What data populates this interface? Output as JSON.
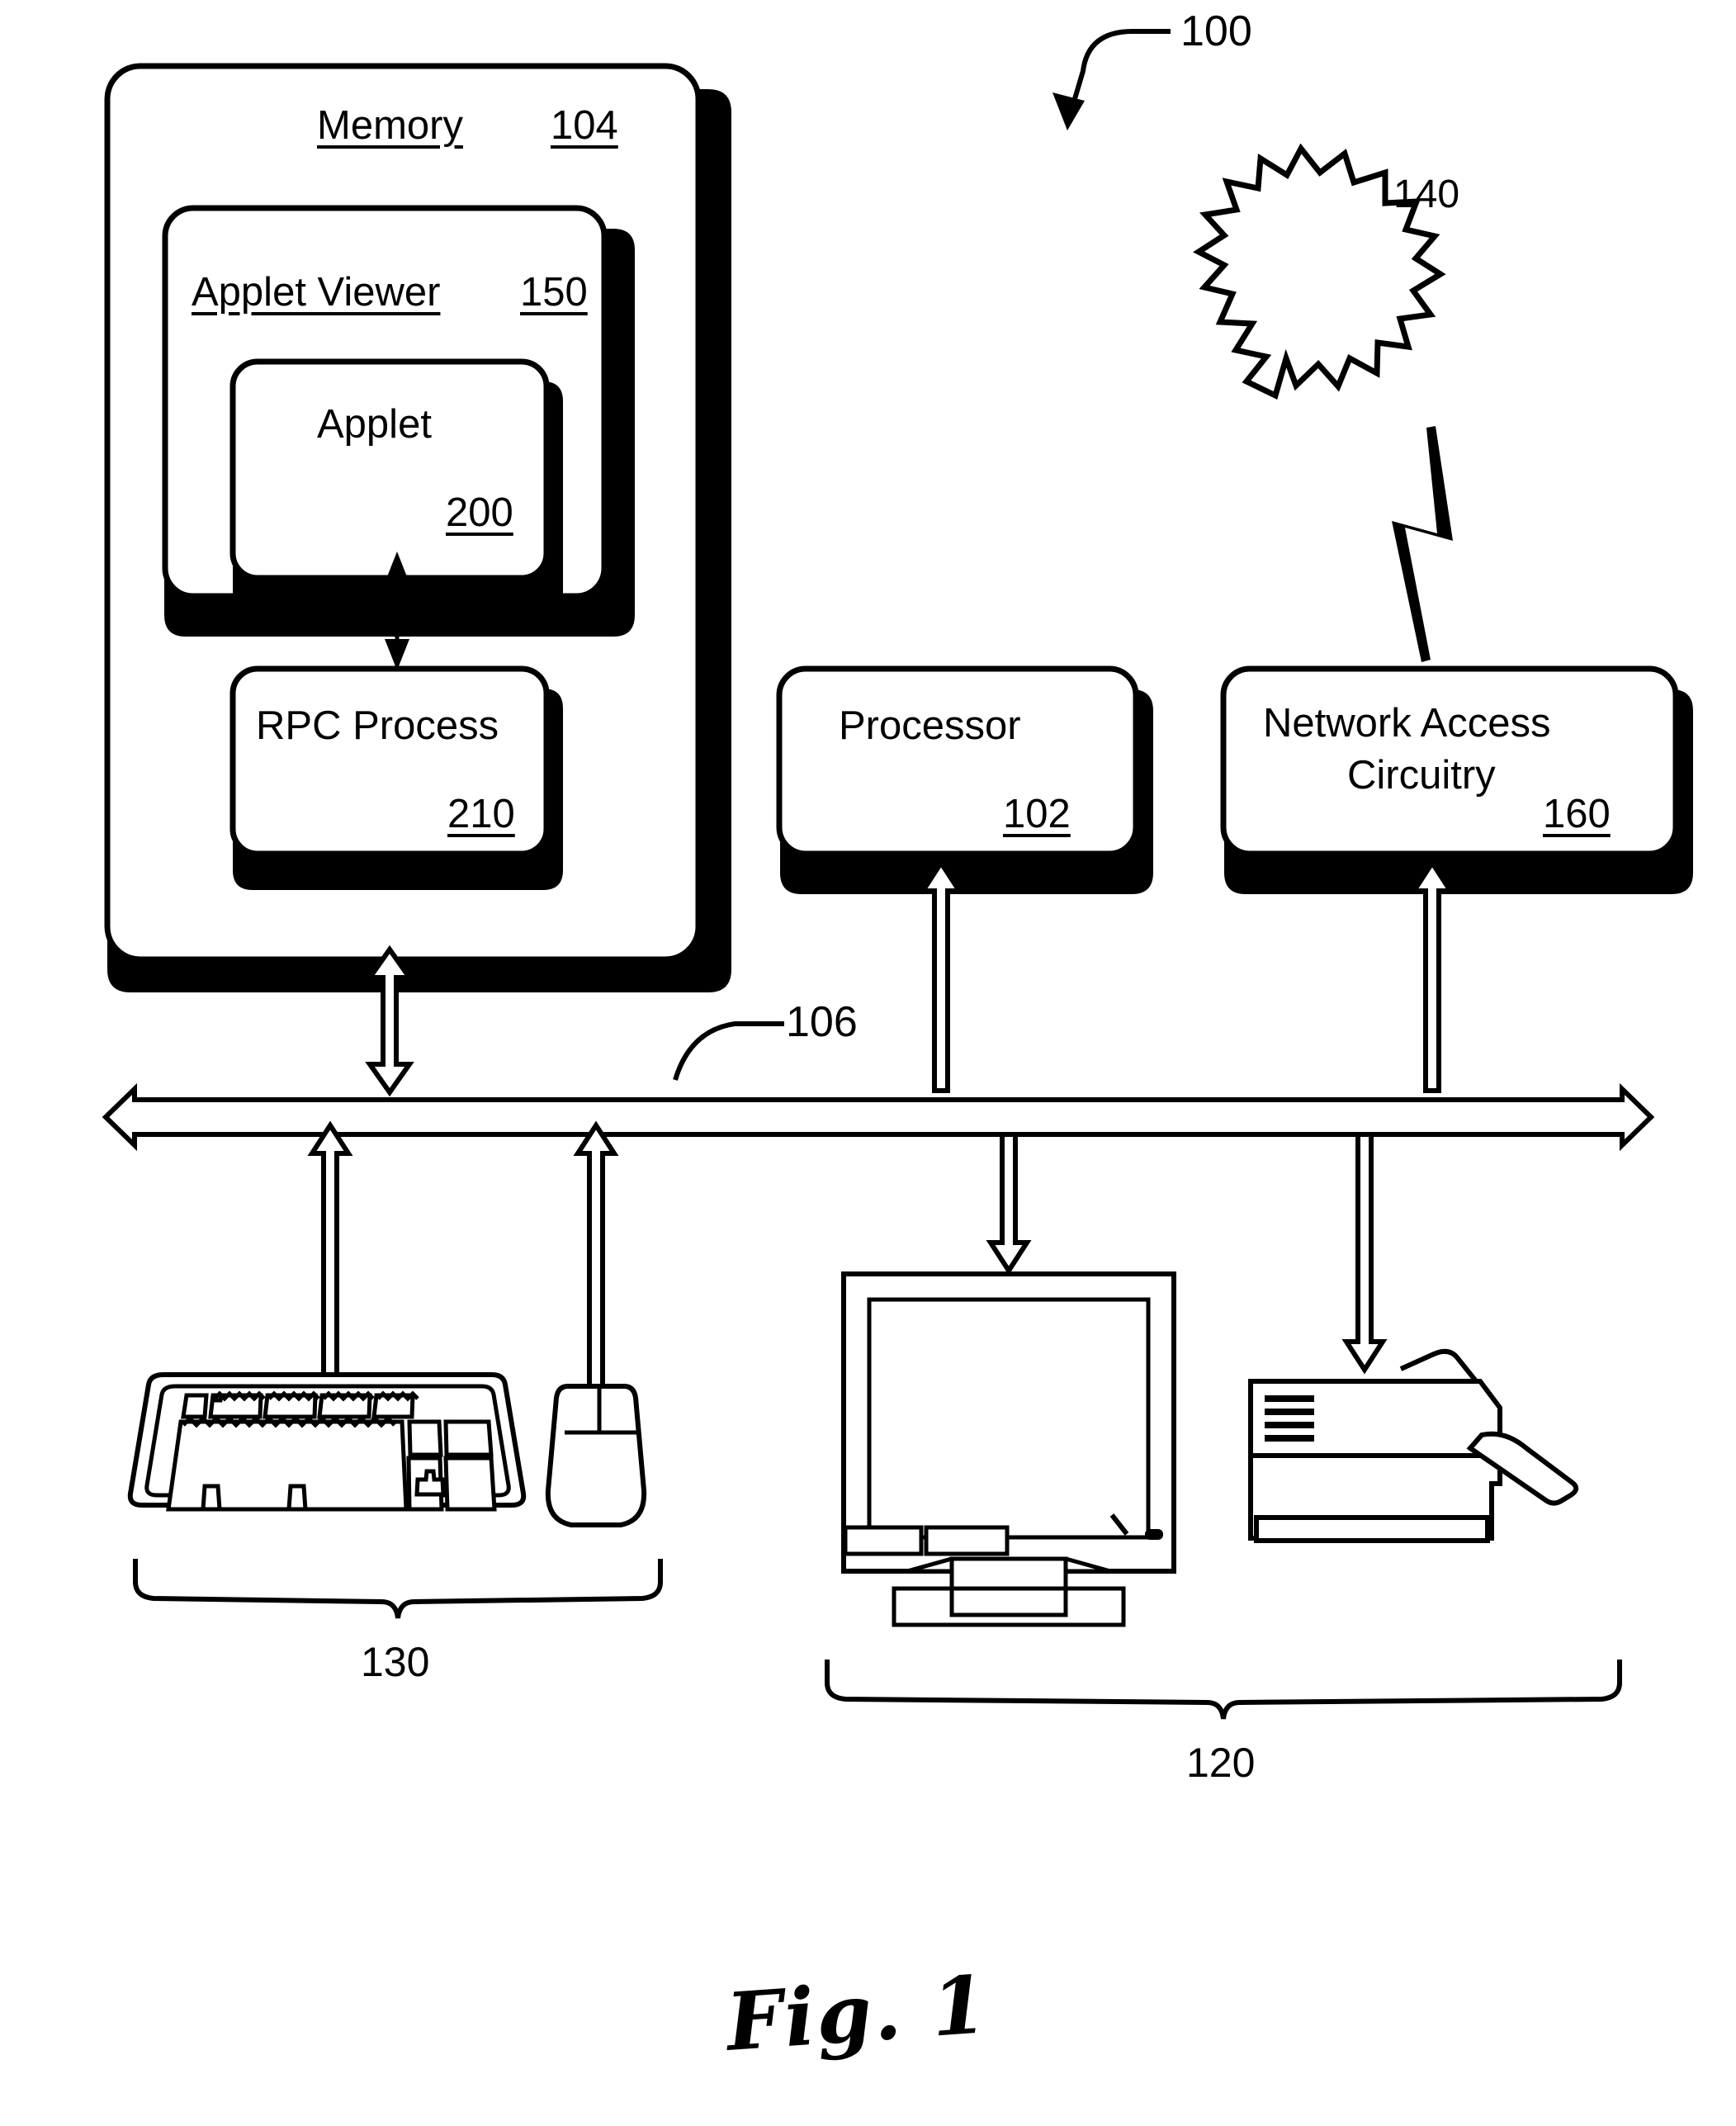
{
  "figure": {
    "caption": "Fig. 1",
    "system_ref": "100"
  },
  "boxes": {
    "memory": {
      "title": "Memory",
      "ref": "104"
    },
    "applet_viewer": {
      "title": "Applet Viewer",
      "ref": "150"
    },
    "applet": {
      "title": "Applet",
      "ref": "200"
    },
    "rpc": {
      "title": "RPC Process",
      "ref": "210"
    },
    "processor": {
      "title": "Processor",
      "ref": "102"
    },
    "network_access": {
      "title_line1": "Network Access",
      "title_line2": "Circuitry",
      "ref": "160"
    }
  },
  "network_cloud": {
    "ref": "140"
  },
  "bus": {
    "ref": "106"
  },
  "groups": {
    "input_devices": {
      "ref": "130"
    },
    "output_devices": {
      "ref": "120"
    }
  },
  "devices": {
    "keyboard": "keyboard",
    "mouse": "mouse",
    "monitor": "monitor",
    "printer": "printer"
  }
}
